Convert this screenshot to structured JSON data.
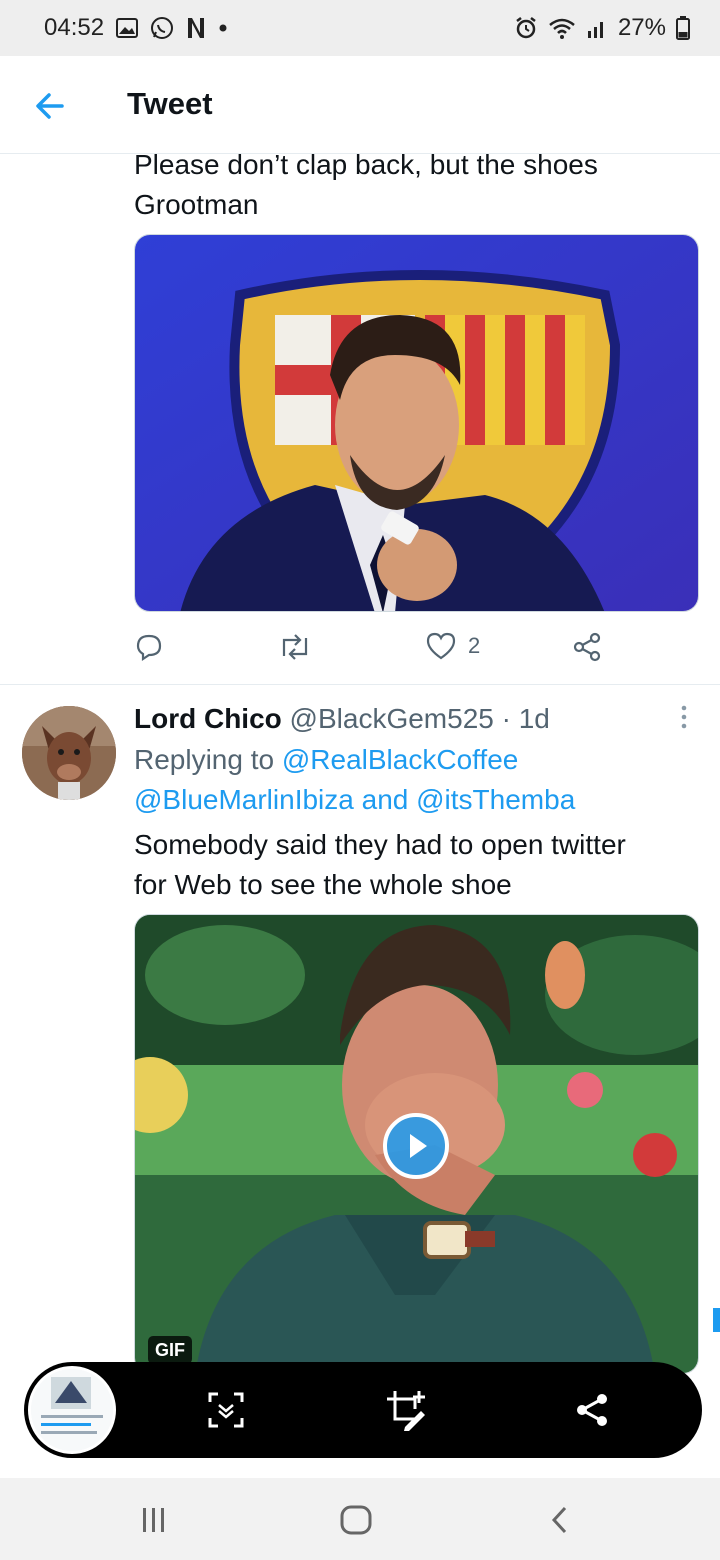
{
  "status_bar": {
    "time": "04:52",
    "battery_percent": "27%",
    "left_icons": [
      "gallery-icon",
      "whatsapp-icon",
      "netflix-icon",
      "dot-icon"
    ],
    "right_icons": [
      "alarm-icon",
      "wifi-icon",
      "signal-icon",
      "battery-icon"
    ]
  },
  "header": {
    "title": "Tweet",
    "back_icon": "arrow-left-icon"
  },
  "tweet": {
    "text_line1": "Please don’t clap back, but the shoes",
    "text_line2": "Grootman",
    "media_icon": "press-conference-photo",
    "actions": {
      "reply_icon": "reply-icon",
      "retweet_icon": "retweet-icon",
      "like_icon": "heart-icon",
      "like_count": "2",
      "share_icon": "share-icon"
    }
  },
  "reply": {
    "author_name": "Lord Chico",
    "handle": "@BlackGem525",
    "separator": "·",
    "time_ago": "1d",
    "replying_to_prefix": "Replying to",
    "mention1": "@RealBlackCoffee",
    "mention2": "@BlueMarlinIbiza",
    "and_word": "and",
    "mention3": "@itsThemba",
    "text_line1": "Somebody said they had to open twitter",
    "text_line2": "for Web to see the whole shoe",
    "media_badge": "GIF"
  },
  "capture_toolbar": {
    "icons": [
      "scroll-capture-icon",
      "crop-edit-icon",
      "share-icon"
    ]
  },
  "nav_bar": {
    "icons": [
      "recents-icon",
      "home-icon",
      "back-icon"
    ]
  },
  "colors": {
    "accent": "#1d9bf0",
    "text": "#0f1419",
    "muted": "#536471",
    "status_bg": "#eeeeee",
    "nav_bg": "#f2f2f2"
  }
}
